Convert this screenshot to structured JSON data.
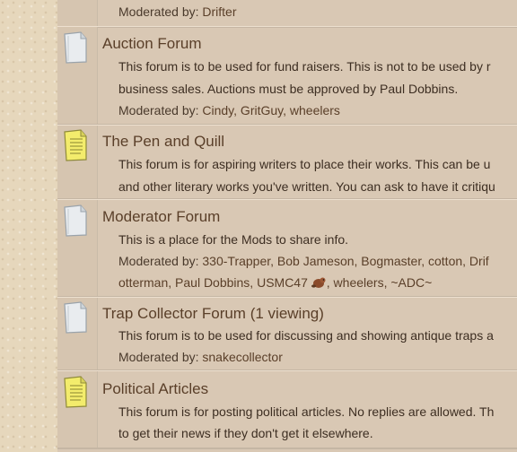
{
  "forums": [
    {
      "id": "top-partial",
      "moderated_prefix": "Moderated by:",
      "moderators": "Drifter"
    },
    {
      "id": "auction",
      "title": "Auction Forum",
      "icon": "document-icon",
      "icon_state": "no-new-posts",
      "desc_line1": "This forum is to be used for fund raisers. This is not to be used by r",
      "desc_line2": "business sales. Auctions must be approved by Paul Dobbins.",
      "moderated_prefix": "Moderated by:",
      "moderators": "Cindy, GritGuy, wheelers"
    },
    {
      "id": "pen-quill",
      "title": "The Pen and Quill",
      "icon": "document-icon",
      "icon_state": "new-posts",
      "desc_line1": "This forum is for aspiring writers to place their works. This can be u",
      "desc_line2": "and other literary works you've written. You can ask to have it critiqu"
    },
    {
      "id": "moderator",
      "title": "Moderator Forum",
      "icon": "document-icon",
      "icon_state": "no-new-posts",
      "desc_line1": "This is a place for the Mods to share info.",
      "moderated_prefix": "Moderated by:",
      "moderators_line1": "330-Trapper, Bob Jameson, Bogmaster, cotton, Drif",
      "moderators_line2a": "otterman, Paul Dobbins, USMC47",
      "moderators_line2b": ", wheelers, ~ADC~"
    },
    {
      "id": "trap-collector",
      "title": "Trap Collector Forum",
      "viewing": "(1 viewing)",
      "icon": "document-icon",
      "icon_state": "no-new-posts",
      "desc_line1": "This forum is to be used for discussing and showing antique traps a",
      "moderated_prefix": "Moderated by:",
      "moderators": "snakecollector"
    },
    {
      "id": "political",
      "title": "Political Articles",
      "icon": "document-icon",
      "icon_state": "new-posts",
      "desc_line1": "This forum is for posting political articles. No replies are allowed. Th",
      "desc_line2": "to get their news if they don't get it elsewhere."
    }
  ],
  "colors": {
    "row_bg": "#d9c8b4",
    "link": "#5a3f29",
    "text": "#3d2e22",
    "new_post_icon": "#f2ea6a"
  }
}
